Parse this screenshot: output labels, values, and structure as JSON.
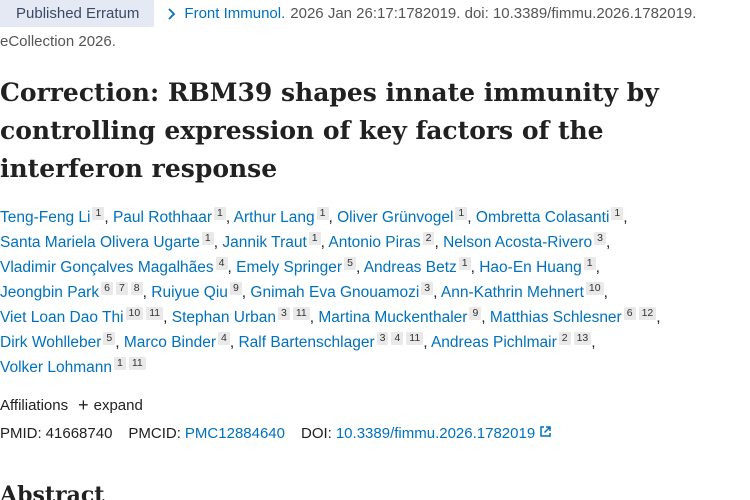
{
  "header": {
    "badge": "Published Erratum",
    "journal": "Front Immunol.",
    "citation": "2026 Jan 26:17:1782019. doi: 10.3389/fimmu.2026.1782019.",
    "ecollection": "eCollection 2026."
  },
  "article": {
    "title": "Correction: RBM39 shapes innate immunity by controlling expression of key factors of the interferon response"
  },
  "authors": [
    {
      "name": "Teng-Feng Li",
      "aff": [
        "1"
      ]
    },
    {
      "name": "Paul Rothhaar",
      "aff": [
        "1"
      ]
    },
    {
      "name": "Arthur Lang",
      "aff": [
        "1"
      ]
    },
    {
      "name": "Oliver Grünvogel",
      "aff": [
        "1"
      ]
    },
    {
      "name": "Ombretta Colasanti",
      "aff": [
        "1"
      ]
    },
    {
      "name": "Santa Mariela Olivera Ugarte",
      "aff": [
        "1"
      ]
    },
    {
      "name": "Jannik Traut",
      "aff": [
        "1"
      ]
    },
    {
      "name": "Antonio Piras",
      "aff": [
        "2"
      ]
    },
    {
      "name": "Nelson Acosta-Rivero",
      "aff": [
        "3"
      ]
    },
    {
      "name": "Vladimir Gonçalves Magalhães",
      "aff": [
        "4"
      ]
    },
    {
      "name": "Emely Springer",
      "aff": [
        "5"
      ]
    },
    {
      "name": "Andreas Betz",
      "aff": [
        "1"
      ]
    },
    {
      "name": "Hao-En Huang",
      "aff": [
        "1"
      ]
    },
    {
      "name": "Jeongbin Park",
      "aff": [
        "6",
        "7",
        "8"
      ]
    },
    {
      "name": "Ruiyue Qiu",
      "aff": [
        "9"
      ]
    },
    {
      "name": "Gnimah Eva Gnouamozi",
      "aff": [
        "3"
      ]
    },
    {
      "name": "Ann-Kathrin Mehnert",
      "aff": [
        "10"
      ]
    },
    {
      "name": "Viet Loan Dao Thi",
      "aff": [
        "10",
        "11"
      ]
    },
    {
      "name": "Stephan Urban",
      "aff": [
        "3",
        "11"
      ]
    },
    {
      "name": "Martina Muckenthaler",
      "aff": [
        "9"
      ]
    },
    {
      "name": "Matthias Schlesner",
      "aff": [
        "6",
        "12"
      ]
    },
    {
      "name": "Dirk Wohlleber",
      "aff": [
        "5"
      ]
    },
    {
      "name": "Marco Binder",
      "aff": [
        "4"
      ]
    },
    {
      "name": "Ralf Bartenschlager",
      "aff": [
        "3",
        "4",
        "11"
      ]
    },
    {
      "name": "Andreas Pichlmair",
      "aff": [
        "2",
        "13"
      ]
    },
    {
      "name": "Volker Lohmann",
      "aff": [
        "1",
        "11"
      ]
    }
  ],
  "affiliations": {
    "label": "Affiliations",
    "expand": "expand",
    "icon": "plus-icon"
  },
  "identifiers": {
    "pmid_label": "PMID:",
    "pmid": "41668740",
    "pmcid_label": "PMCID:",
    "pmcid": "PMC12884640",
    "doi_label": "DOI:",
    "doi": "10.3389/fimmu.2026.1782019",
    "doi_icon": "external-link-icon"
  },
  "abstract_heading": "Abstract"
}
